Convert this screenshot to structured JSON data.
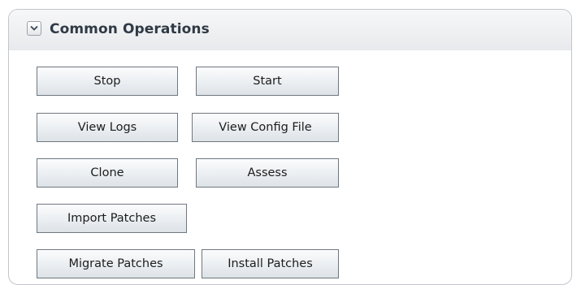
{
  "panel": {
    "title": "Common Operations",
    "toggle_icon": "chevron-down-icon",
    "colors": {
      "title_text": "#2f3a45",
      "border": "#c2c6cd",
      "button_border": "#6f7780"
    }
  },
  "buttons": {
    "stop": "Stop",
    "start": "Start",
    "view_logs": "View Logs",
    "view_config_file": "View Config File",
    "clone": "Clone",
    "assess": "Assess",
    "import_patches": "Import Patches",
    "migrate_patches": "Migrate Patches",
    "install_patches": "Install Patches"
  }
}
